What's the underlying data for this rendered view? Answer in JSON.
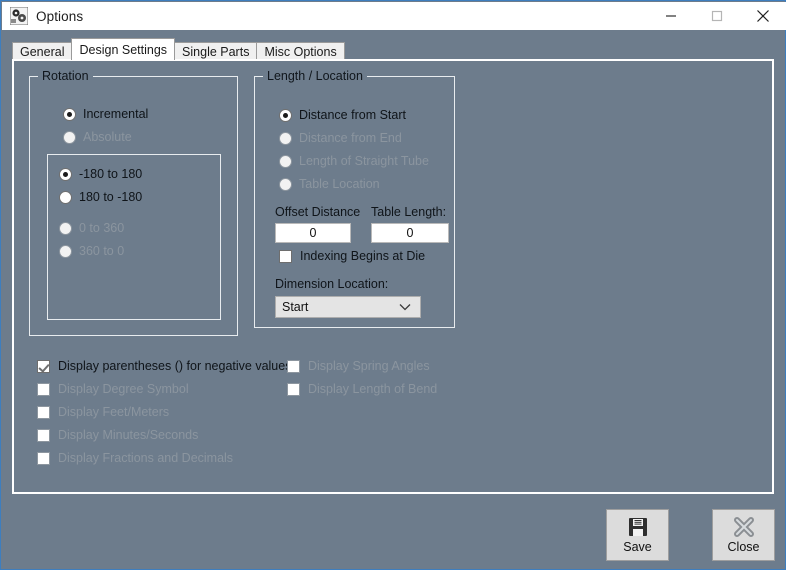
{
  "window": {
    "title": "Options",
    "icon": "app-gears-icon",
    "controls": {
      "minimize": "minimize-icon",
      "maximize": "maximize-icon",
      "close": "close-icon"
    }
  },
  "tabs": [
    {
      "label": "General",
      "active": false
    },
    {
      "label": "Design Settings",
      "active": true
    },
    {
      "label": "Single Parts",
      "active": false
    },
    {
      "label": "Misc Options",
      "active": false
    }
  ],
  "rotation_group": {
    "label": "Rotation",
    "mode_options": [
      {
        "label": "Incremental",
        "selected": true,
        "enabled": true
      },
      {
        "label": "Absolute",
        "selected": false,
        "enabled": false
      }
    ],
    "range_options": [
      {
        "label": "-180 to  180",
        "selected": true,
        "enabled": true
      },
      {
        "label": "180 to  -180",
        "selected": false,
        "enabled": true
      },
      {
        "label": "0 to  360",
        "selected": false,
        "enabled": false
      },
      {
        "label": "360 to  0",
        "selected": false,
        "enabled": false
      }
    ]
  },
  "length_location_group": {
    "label": "Length / Location",
    "options": [
      {
        "label": "Distance from Start",
        "selected": true,
        "enabled": true
      },
      {
        "label": "Distance from End",
        "selected": false,
        "enabled": false
      },
      {
        "label": "Length of Straight Tube",
        "selected": false,
        "enabled": false
      },
      {
        "label": "Table Location",
        "selected": false,
        "enabled": false
      }
    ],
    "offset_distance": {
      "label": "Offset Distance",
      "value": "0"
    },
    "table_length": {
      "label": "Table Length:",
      "value": "0"
    },
    "indexing_checkbox": {
      "label": "Indexing Begins at Die",
      "checked": false,
      "enabled": true
    },
    "dimension_location": {
      "label": "Dimension Location:",
      "value": "Start"
    }
  },
  "display_options_left": [
    {
      "label": "Display parentheses () for negative values",
      "checked": true,
      "enabled": true
    },
    {
      "label": "Display Degree Symbol",
      "checked": false,
      "enabled": false
    },
    {
      "label": "Display Feet/Meters",
      "checked": false,
      "enabled": false
    },
    {
      "label": "Display Minutes/Seconds",
      "checked": false,
      "enabled": false
    },
    {
      "label": "Display Fractions and Decimals",
      "checked": false,
      "enabled": false
    }
  ],
  "display_options_right": [
    {
      "label": "Display Spring Angles",
      "checked": false,
      "enabled": false
    },
    {
      "label": "Display Length of Bend",
      "checked": false,
      "enabled": false
    }
  ],
  "buttons": {
    "save": {
      "label": "Save",
      "icon": "floppy-disk-icon"
    },
    "close": {
      "label": "Close",
      "icon": "x-mark-icon"
    }
  },
  "colors": {
    "window_background": "#6d7c8c",
    "window_frame": "#4a86c8",
    "titlebar": "#ffffff",
    "panel_border": "#ffffff",
    "button_face": "#dcdcdc"
  }
}
